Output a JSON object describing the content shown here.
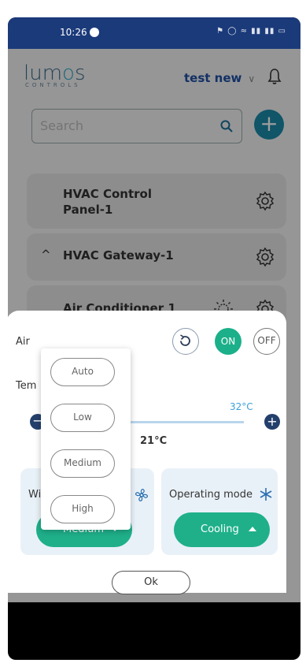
{
  "status_bar": {
    "time": "10:26"
  },
  "header": {
    "logo_main": "lum",
    "logo_accent": "o",
    "logo_tail": "s",
    "logo_sub": "CONTROLS",
    "user_name": "test new",
    "user_chevron": "∨"
  },
  "search": {
    "placeholder": "Search"
  },
  "add_button": "+",
  "devices": [
    {
      "label_line1": "HVAC Control",
      "label_line2": "Panel-1"
    },
    {
      "label": "HVAC Gateway-1",
      "expander": "^"
    },
    {
      "label": "Air Conditioner 1"
    }
  ],
  "control_sheet": {
    "ac_label": "Air",
    "temp_label": "Tem",
    "on_label": "ON",
    "off_label": "OFF",
    "min_sign": "−",
    "plus_sign": "+",
    "max_temp": "32°C",
    "current_temp": "21°C",
    "fan_label": "Wi",
    "fan_value": "Medium",
    "mode_label": "Operating mode",
    "mode_value": "Cooling",
    "ok_label": "Ok"
  },
  "fan_dropdown": {
    "options": [
      "Auto",
      "Low",
      "Medium",
      "High"
    ]
  },
  "colors": {
    "accent_green": "#1fb08a",
    "brand_blue": "#1f4fa3",
    "status_bar": "#1b3a7a"
  }
}
